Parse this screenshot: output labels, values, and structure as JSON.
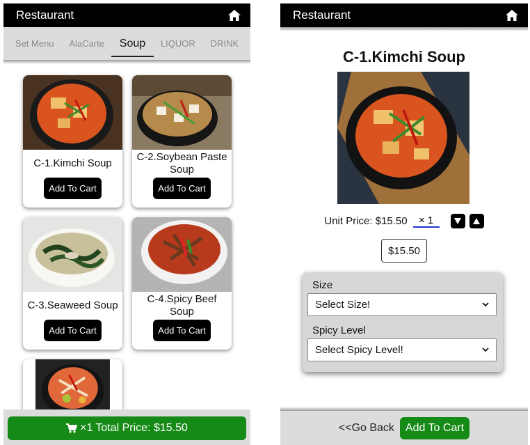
{
  "app": {
    "title": "Restaurant"
  },
  "tabs": [
    {
      "label": "Set Menu"
    },
    {
      "label": "AlaCarte"
    },
    {
      "label": "Soup"
    },
    {
      "label": "LIQUOR"
    },
    {
      "label": "DRINK"
    }
  ],
  "active_tab": "Soup",
  "items": [
    {
      "name": "C-1.Kimchi Soup",
      "button": "Add To Cart"
    },
    {
      "name": "C-2.Soybean Paste Soup",
      "button": "Add To Cart"
    },
    {
      "name": "C-3.Seaweed Soup",
      "button": "Add To Cart"
    },
    {
      "name": "C-4.Spicy Beef Soup",
      "button": "Add To Cart"
    }
  ],
  "cart_bar": {
    "quantity": "×1",
    "label": "Total Price: $15.50"
  },
  "detail": {
    "title": "C-1.Kimchi Soup",
    "unit_price_label": "Unit Price: $15.50",
    "quantity_value": "× 1",
    "price_box": "$15.50",
    "size_label": "Size",
    "size_select": "Select Size!",
    "spicy_label": "Spicy Level",
    "spicy_select": "Select Spicy Level!",
    "back_label": "<<Go Back",
    "add_label": "Add To Cart"
  },
  "icons": {
    "home": "home-icon",
    "cart": "cart-icon",
    "down": "arrow-down-icon",
    "up": "arrow-up-icon",
    "chevron": "chevron-down-icon"
  },
  "colors": {
    "bar": "#000000",
    "tabs_bg": "#dcdcdc",
    "green": "#168a16",
    "underline": "#2233cc"
  }
}
